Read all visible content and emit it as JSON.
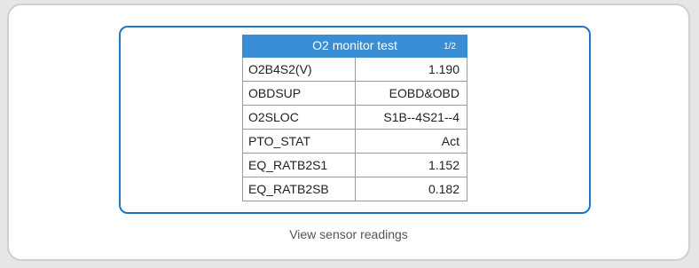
{
  "screen": {
    "title": "O2 monitor test",
    "page_indicator": "1/2",
    "rows": [
      {
        "name": "O2B4S2(V)",
        "value": "1.190"
      },
      {
        "name": "OBDSUP",
        "value": "EOBD&OBD"
      },
      {
        "name": "O2SLOC",
        "value": "S1B--4S21--4"
      },
      {
        "name": "PTO_STAT",
        "value": "Act"
      },
      {
        "name": "EQ_RATB2S1",
        "value": "1.152"
      },
      {
        "name": "EQ_RATB2SB",
        "value": "0.182"
      }
    ]
  },
  "caption": "View sensor readings",
  "colors": {
    "header_bg": "#3a8ed6",
    "frame_border": "#1f74c4"
  }
}
